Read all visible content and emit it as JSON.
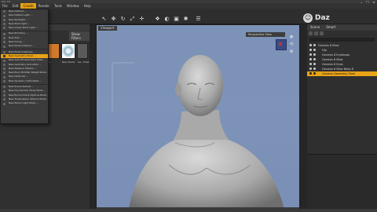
{
  "app": {
    "title": "Daz 3D"
  },
  "menu": [
    {
      "label": "File",
      "active": false
    },
    {
      "label": "Edit",
      "active": false
    },
    {
      "label": "Create",
      "active": true
    },
    {
      "label": "Render",
      "active": false
    },
    {
      "label": "Tools",
      "active": false
    },
    {
      "label": "Window",
      "active": false
    },
    {
      "label": "Help",
      "active": false
    }
  ],
  "logo": {
    "text": "Daz"
  },
  "dropdown": {
    "items": [
      "New Camera ...",
      "New Distant Light ...",
      "New Spotlight ...",
      "New Point Light ...",
      "New Linear Point Light ...",
      "New Primitive ...",
      "New Null ...",
      "New Group ...",
      "New Node Instance ...",
      "New Node Instances ...",
      "New Geometry Shell ...",
      "New Auto-Fit Geometry Shell ...",
      "New Geometry Smoother ...",
      "New Measure Metrics ...",
      "New Push Modifier Weight Node ...",
      "New Deformer ...",
      "New Dynamic Cloth Node ...",
      "New Scene Subset ...",
      "New Iray Section Plane Node ...",
      "New Environment Options Node ...",
      "New Tonemapper Options Node ...",
      "New Planar Light Node ..."
    ],
    "highlight_index": 10
  },
  "left_panel": {
    "button_a": "Show Filters",
    "thumbs": [
      "Ge...",
      "New Shells",
      "Ge...Shell"
    ]
  },
  "viewport": {
    "tab": "Viewport",
    "camera_select": "Perspective View"
  },
  "right_panel": {
    "tabs": [
      "Scene",
      "Smart"
    ],
    "items": [
      {
        "label": "Genesis 8 Male",
        "selected": false
      },
      {
        "label": "Hip",
        "selected": false
      },
      {
        "label": "Genesis 8 Eyebrows",
        "selected": false
      },
      {
        "label": "Genesis 8 Male",
        "selected": false
      },
      {
        "label": "Genesis 8 Eyes",
        "selected": false
      },
      {
        "label": "Genesis 8 Male Body 8",
        "selected": false
      },
      {
        "label": "Genesis Geometry Shell",
        "selected": true
      }
    ]
  }
}
